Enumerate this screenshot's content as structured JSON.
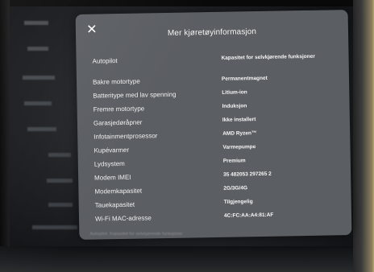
{
  "dialog": {
    "title": "Mer kjøretøyinformasjon",
    "close_icon": "close-icon",
    "rows": [
      {
        "key": "Autopilot",
        "value": "Kapasitet for selvkjørende funksjoner"
      },
      {
        "key": "Bakre motortype",
        "value": "Permanentmagnet"
      },
      {
        "key": "Batteritype med lav spenning",
        "value": "Litium-ion"
      },
      {
        "key": "Fremre motortype",
        "value": "Induksjon"
      },
      {
        "key": "Garasjedøråpner",
        "value": "Ikke installert"
      },
      {
        "key": "Infotainmentprosessor",
        "value": "AMD Ryzen™"
      },
      {
        "key": "Kupévarmer",
        "value": "Varmepumpe"
      },
      {
        "key": "Lydsystem",
        "value": "Premium"
      },
      {
        "key": "Modem IMEI",
        "value": "35 482053 297265 2"
      },
      {
        "key": "Modemkapasitet",
        "value": "2G/3G/4G"
      },
      {
        "key": "Tauekapasitet",
        "value": "Tilgjengelig"
      },
      {
        "key": "Wi-Fi MAC-adresse",
        "value": "4C:FC:AA:A4:81:AF"
      }
    ],
    "footer_note": "Autopilot: Kapasitet for selvkjørende funksjoner"
  }
}
